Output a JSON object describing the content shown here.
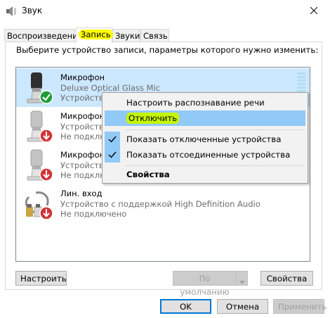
{
  "window": {
    "title": "Звук",
    "close_icon": "close-icon"
  },
  "tabs": [
    {
      "label": "Воспроизведение",
      "active": false
    },
    {
      "label": "Запись",
      "active": true
    },
    {
      "label": "Звуки",
      "active": false
    },
    {
      "label": "Связь",
      "active": false
    }
  ],
  "instruction": "Выберите устройство записи, параметры которого нужно изменить:",
  "devices": [
    {
      "name": "Микрофон",
      "desc": "Deluxe Optical Glass Mic",
      "status": "Устройство по умолчанию",
      "status_visible": "Устройств",
      "badge": "check-icon"
    },
    {
      "name": "Микрофон",
      "desc": "",
      "status": "Не подключено",
      "status_visible": "Не подклю",
      "badge": "down-arrow-icon"
    },
    {
      "name": "Микрофон",
      "desc": "",
      "status": "Не подключено",
      "status_visible": "Не подклю",
      "badge": "down-arrow-icon"
    },
    {
      "name": "Лин. вход",
      "desc": "Устройство с поддержкой High Definition Audio",
      "status": "Не подключено",
      "badge": "down-arrow-icon"
    }
  ],
  "device_desc_visible": [
    "Устройство",
    "Устройство"
  ],
  "context_menu": {
    "items": [
      {
        "label": "Настроить распознавание речи",
        "checked": false
      },
      {
        "label": "Отключить",
        "highlighted": true
      },
      {
        "label": "Показать отключенные устройства",
        "checked": true
      },
      {
        "label": "Показать отсоединенные устройства",
        "checked": true
      },
      {
        "label": "Свойства",
        "bold": true
      }
    ]
  },
  "buttons": {
    "configure": "Настроить",
    "set_default": "По умолчанию",
    "properties": "Свойства",
    "ok": "OK",
    "cancel": "Отмена",
    "apply": "Применить"
  },
  "colors": {
    "selection": "#cce8ff",
    "menu_hover": "#91c9f7",
    "tab_highlight": "#ffff00",
    "item_highlight": "#c6f500",
    "accent": "#0078d7"
  }
}
